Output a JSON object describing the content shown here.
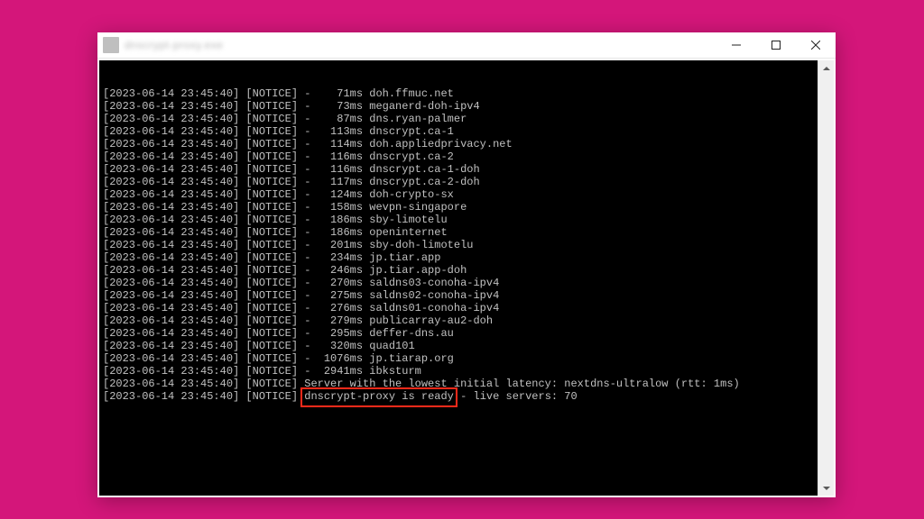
{
  "window": {
    "title": "dnscrypt-proxy.exe"
  },
  "highlight": {
    "text": "dnscrypt-proxy is ready"
  },
  "log": {
    "timestamp": "[2023-06-14 23:45:40]",
    "level": "[NOTICE]",
    "entries": [
      {
        "latency_ms": 71,
        "server": "doh.ffmuc.net"
      },
      {
        "latency_ms": 73,
        "server": "meganerd-doh-ipv4"
      },
      {
        "latency_ms": 87,
        "server": "dns.ryan-palmer"
      },
      {
        "latency_ms": 113,
        "server": "dnscrypt.ca-1"
      },
      {
        "latency_ms": 114,
        "server": "doh.appliedprivacy.net"
      },
      {
        "latency_ms": 116,
        "server": "dnscrypt.ca-2"
      },
      {
        "latency_ms": 116,
        "server": "dnscrypt.ca-1-doh"
      },
      {
        "latency_ms": 117,
        "server": "dnscrypt.ca-2-doh"
      },
      {
        "latency_ms": 124,
        "server": "doh-crypto-sx"
      },
      {
        "latency_ms": 158,
        "server": "wevpn-singapore"
      },
      {
        "latency_ms": 186,
        "server": "sby-limotelu"
      },
      {
        "latency_ms": 186,
        "server": "openinternet"
      },
      {
        "latency_ms": 201,
        "server": "sby-doh-limotelu"
      },
      {
        "latency_ms": 234,
        "server": "jp.tiar.app"
      },
      {
        "latency_ms": 246,
        "server": "jp.tiar.app-doh"
      },
      {
        "latency_ms": 270,
        "server": "saldns03-conoha-ipv4"
      },
      {
        "latency_ms": 275,
        "server": "saldns02-conoha-ipv4"
      },
      {
        "latency_ms": 276,
        "server": "saldns01-conoha-ipv4"
      },
      {
        "latency_ms": 279,
        "server": "publicarray-au2-doh"
      },
      {
        "latency_ms": 295,
        "server": "deffer-dns.au"
      },
      {
        "latency_ms": 320,
        "server": "quad101"
      },
      {
        "latency_ms": 1076,
        "server": "jp.tiarap.org"
      },
      {
        "latency_ms": 2941,
        "server": "ibksturm"
      }
    ],
    "summary1": "Server with the lowest initial latency: nextdns-ultralow (rtt: 1ms)",
    "summary2_prefix": "dnscrypt-proxy is ready",
    "summary2_suffix": " - live servers: 70"
  }
}
